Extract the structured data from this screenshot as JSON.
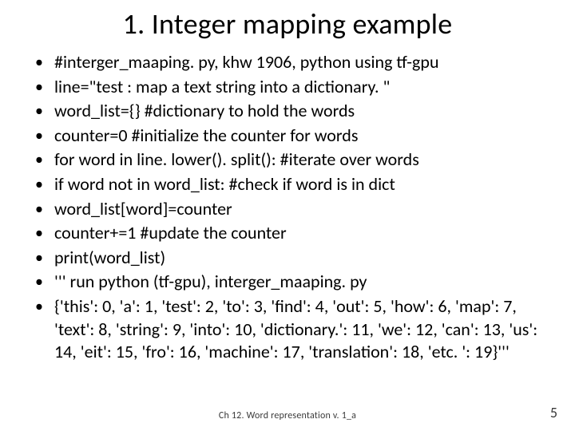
{
  "title": "1. Integer mapping example",
  "bullets": [
    "#interger_maaping. py, khw 1906, python using tf-gpu",
    "line=\"test : map a text string into a dictionary. \"",
    "word_list={} #dictionary to hold the words",
    "counter=0 #initialize the counter for words",
    "for word in line. lower(). split(): #iterate over words",
    "if word not in word_list: #check if word is in dict",
    "  word_list[word]=counter",
    "  counter+=1 #update the counter",
    "  print(word_list)",
    "''' run python (tf-gpu), interger_maaping. py",
    "{'this': 0, 'a': 1, 'test': 2, 'to': 3, 'find': 4, 'out': 5, 'how': 6, 'map': 7, 'text': 8, 'string': 9, 'into': 10, 'dictionary.': 11, 'we': 12, 'can': 13, 'us': 14, 'eit': 15, 'fro': 16, 'machine': 17, 'translation': 18, 'etc. ': 19}'''"
  ],
  "footer_center": "Ch 12. Word representation v. 1_a",
  "footer_right": "5"
}
